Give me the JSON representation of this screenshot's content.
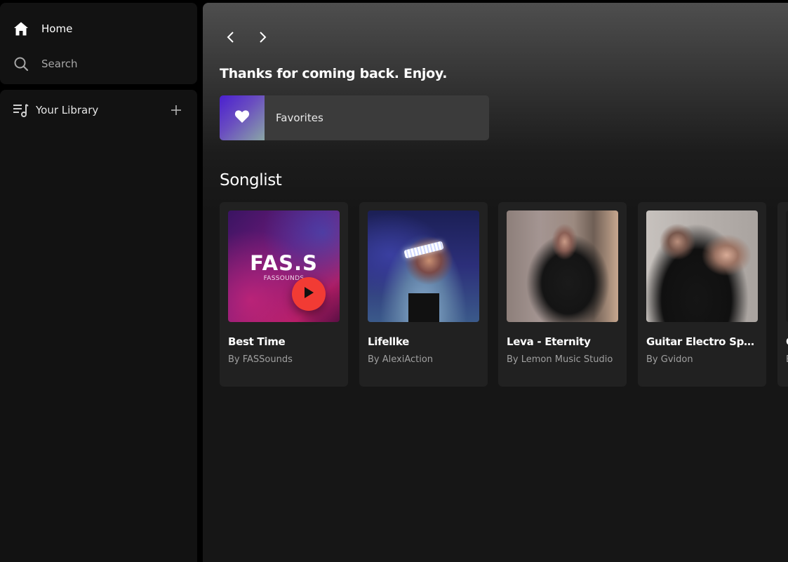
{
  "sidebar": {
    "nav": [
      {
        "label": "Home",
        "icon": "home-icon"
      },
      {
        "label": "Search",
        "icon": "search-icon"
      }
    ],
    "library": {
      "label": "Your Library",
      "icon": "library-icon",
      "add_icon": "plus-icon"
    }
  },
  "main": {
    "greeting": "Thanks for coming back. Enjoy.",
    "favorites": {
      "label": "Favorites",
      "icon": "heart-icon"
    },
    "songlist_title": "Songlist",
    "songs": [
      {
        "title": "Best Time",
        "artist": "By FASSounds",
        "art_text": "FAS.S",
        "art_subtext": "FASSOUNDS"
      },
      {
        "title": "Lifellke",
        "artist": "By AlexiAction"
      },
      {
        "title": "Leva - Eternity",
        "artist": "By Lemon Music Studio"
      },
      {
        "title": "Guitar Electro Sport Trailer",
        "artist": "By Gvidon"
      },
      {
        "title": "G",
        "artist": "B"
      }
    ]
  },
  "colors": {
    "accent_play": "#f23b34",
    "panel_bg": "#121212",
    "card_bg": "#212121"
  }
}
